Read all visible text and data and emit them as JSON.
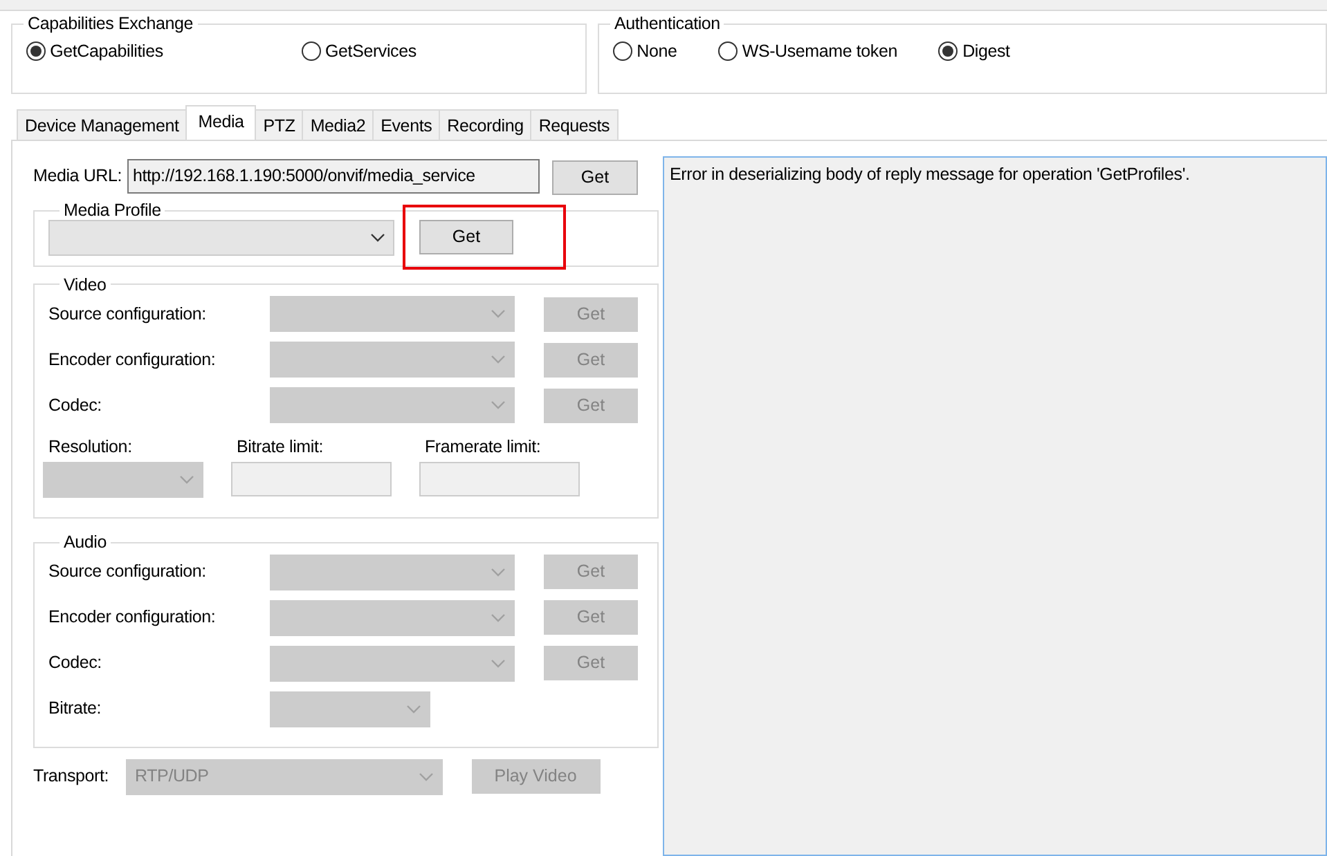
{
  "capabilities_exchange": {
    "title": "Capabilities Exchange",
    "options": [
      {
        "label": "GetCapabilities",
        "selected": true
      },
      {
        "label": "GetServices",
        "selected": false
      }
    ]
  },
  "authentication": {
    "title": "Authentication",
    "options": [
      {
        "label": "None",
        "selected": false
      },
      {
        "label": "WS-Usemame token",
        "selected": false
      },
      {
        "label": "Digest",
        "selected": true
      }
    ]
  },
  "tabs": [
    {
      "label": "Device Management",
      "selected": false
    },
    {
      "label": "Media",
      "selected": true
    },
    {
      "label": "PTZ",
      "selected": false
    },
    {
      "label": "Media2",
      "selected": false
    },
    {
      "label": "Events",
      "selected": false
    },
    {
      "label": "Recording",
      "selected": false
    },
    {
      "label": "Requests",
      "selected": false
    }
  ],
  "media_url": {
    "label": "Media URL:",
    "value": "http://192.168.1.190:5000/onvif/media_service",
    "button": {
      "label": "Get",
      "disabled": false
    }
  },
  "media_profile": {
    "title": "Media Profile",
    "combo": {
      "disabled": false
    },
    "button": {
      "label": "Get",
      "disabled": false,
      "highlighted": true
    }
  },
  "video": {
    "title": "Video",
    "rows": [
      {
        "kind": "combo_get",
        "label": "Source configuration:",
        "combo": {
          "disabled": true
        },
        "button": {
          "label": "Get",
          "disabled": true
        }
      },
      {
        "kind": "combo_get",
        "label": "Encoder configuration:",
        "combo": {
          "disabled": true
        },
        "button": {
          "label": "Get",
          "disabled": true
        }
      },
      {
        "kind": "combo_get",
        "label": "Codec:",
        "combo": {
          "disabled": true
        },
        "button": {
          "label": "Get",
          "disabled": true
        }
      }
    ],
    "limits": [
      {
        "kind": "combo",
        "label": "Resolution:",
        "disabled": true
      },
      {
        "kind": "field",
        "label": "Bitrate limit:",
        "disabled": true
      },
      {
        "kind": "field",
        "label": "Framerate limit:",
        "disabled": true
      }
    ]
  },
  "audio": {
    "title": "Audio",
    "rows": [
      {
        "kind": "combo_get",
        "label": "Source configuration:",
        "combo": {
          "disabled": true
        },
        "button": {
          "label": "Get",
          "disabled": true
        }
      },
      {
        "kind": "combo_get",
        "label": "Encoder configuration:",
        "combo": {
          "disabled": true
        },
        "button": {
          "label": "Get",
          "disabled": true
        }
      },
      {
        "kind": "combo_get",
        "label": "Codec:",
        "combo": {
          "disabled": true
        },
        "button": {
          "label": "Get",
          "disabled": true
        }
      },
      {
        "kind": "combo",
        "label": "Bitrate:",
        "combo": {
          "disabled": true
        }
      }
    ]
  },
  "transport": {
    "label": "Transport:",
    "value": "RTP/UDP",
    "disabled": true,
    "button": {
      "label": "Play Video",
      "disabled": true
    }
  },
  "output": {
    "text": "Error in deserializing body of reply message for operation 'GetProfiles'."
  }
}
